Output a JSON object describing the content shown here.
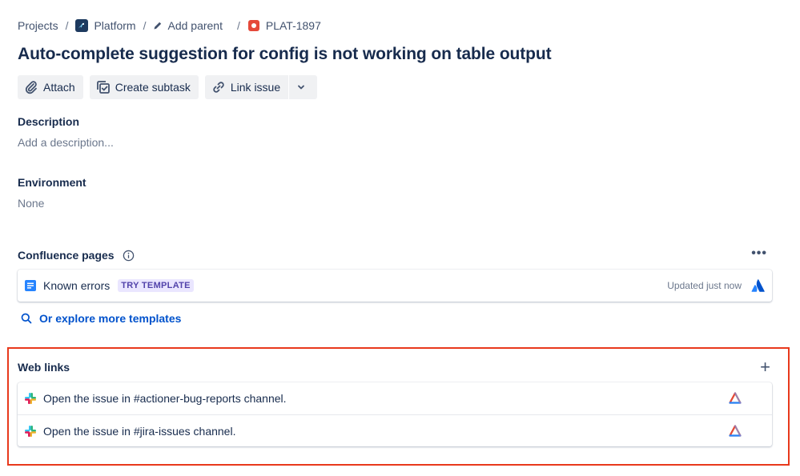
{
  "breadcrumb": {
    "projects": "Projects",
    "project": "Platform",
    "add_parent": "Add parent",
    "issue_key": "PLAT-1897",
    "separator": "/"
  },
  "issue": {
    "title": "Auto-complete suggestion for config is not working on table output"
  },
  "toolbar": {
    "attach": "Attach",
    "create_subtask": "Create subtask",
    "link_issue": "Link issue"
  },
  "description": {
    "heading": "Description",
    "placeholder": "Add a description..."
  },
  "environment": {
    "heading": "Environment",
    "value": "None"
  },
  "confluence": {
    "heading": "Confluence pages",
    "more": "•••",
    "page": {
      "title": "Known errors",
      "lozenge": "TRY TEMPLATE",
      "updated": "Updated just now"
    },
    "explore": "Or explore more templates"
  },
  "web_links": {
    "heading": "Web links",
    "add": "+",
    "items": [
      {
        "label": "Open the issue in #actioner-bug-reports channel."
      },
      {
        "label": "Open the issue in #jira-issues channel."
      }
    ]
  },
  "colors": {
    "text": "#172b4d",
    "muted": "#6b778c",
    "link": "#0052cc",
    "highlight_border": "#e8391c",
    "lozenge_text": "#5243aa",
    "lozenge_bg": "#eae6ff"
  }
}
